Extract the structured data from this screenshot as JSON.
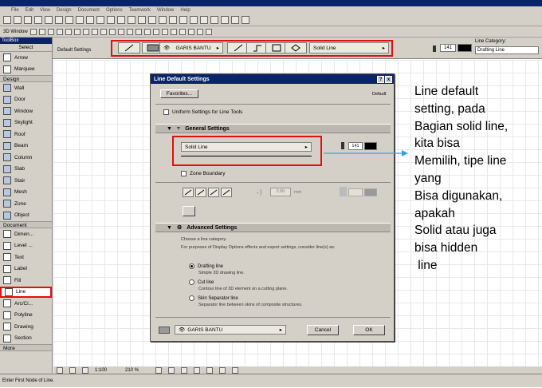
{
  "menubar": {
    "items": [
      "File",
      "Edit",
      "View",
      "Design",
      "Document",
      "Options",
      "Teamwork",
      "Window",
      "Help"
    ]
  },
  "toolbar2": {
    "window_label": "3D Window"
  },
  "infobox": {
    "title": "Default Settings",
    "pen_dropdown": "GARIS BANTU",
    "line_type_dropdown": "Solid Line",
    "pen_number": "141",
    "category_label": "Line Category:",
    "category_value": "Drafting Line"
  },
  "toolbox": {
    "title": "ToolBox",
    "select_label": "Select",
    "items_top": [
      "Arrow",
      "Marquee"
    ],
    "design_label": "Design",
    "design_items": [
      "Wall",
      "Door",
      "Window",
      "Skylight",
      "Roof",
      "Beam",
      "Column",
      "Slab",
      "Stair",
      "Mesh",
      "Zone",
      "Object"
    ],
    "document_label": "Document",
    "document_items": [
      "Dimen...",
      "Level ...",
      "Text",
      "Label",
      "Fill",
      "Line",
      "Arc/Ci...",
      "Polyline",
      "Drawing",
      "Section"
    ],
    "more_label": "More"
  },
  "dialog": {
    "title": "Line Default Settings",
    "favorites_button": "Favorites...",
    "default_label": "Default",
    "uniform_checkbox": "Uniform Settings for Line Tools",
    "general_heading": "General Settings",
    "line_type": "Solid Line",
    "pen_number": "141",
    "zone_boundary": "Zone Boundary",
    "scale_value": "2.00",
    "scale_unit": "mm",
    "advanced_heading": "Advanced Settings",
    "choose_text": "Choose a line category.",
    "purpose_text": "For purposes of Display Options effects and export settings, consider line(s) as:",
    "option1_label": "Drafting line",
    "option1_desc": "Simple 2D drawing line.",
    "option2_label": "Cut line",
    "option2_desc": "Contour line of 3D element on a cutting plane.",
    "option3_label": "Skin Separator line",
    "option3_desc": "Separator line between skins of composite structures.",
    "footer_layer": "GARIS BANTU",
    "cancel_button": "Cancel",
    "ok_button": "OK"
  },
  "annotation": {
    "lines": [
      "Line default",
      "setting, pada",
      "Bagian solid line,",
      "kita bisa",
      "Memilih, tipe line",
      "yang",
      "Bisa digunakan,",
      "apakah",
      "Solid atau juga",
      "bisa hidden",
      " line"
    ]
  },
  "bottombar": {
    "scale": "1:100",
    "zoom": "210 %"
  },
  "statusbar": {
    "text": "Enter First Node of Line."
  },
  "colors": {
    "highlight_red": "#e01010",
    "arrow_blue": "#3aa0e0",
    "title_blue": "#0a246a"
  }
}
